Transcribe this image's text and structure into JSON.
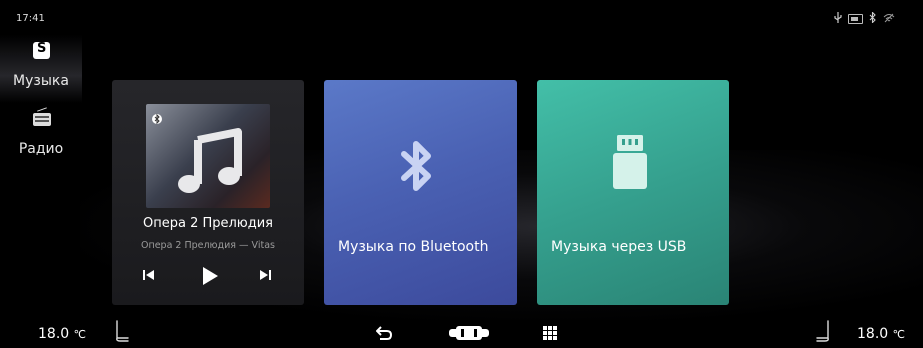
{
  "status_bar": {
    "time": "17:41",
    "icons": [
      "usb-icon",
      "battery-icon",
      "bluetooth-icon",
      "wifi-icon"
    ]
  },
  "sidebar": {
    "items": [
      {
        "label": "Музыка",
        "icon": "music-app-icon",
        "active": true
      },
      {
        "label": "Радио",
        "icon": "radio-icon",
        "active": false
      }
    ]
  },
  "player": {
    "title": "Опера 2 Прелюдия",
    "subtitle": "Опера 2 Прелюдия — Vitas",
    "controls": [
      "previous-icon",
      "play-icon",
      "next-icon"
    ]
  },
  "sources": [
    {
      "label": "Музыка по Bluetooth",
      "icon": "bluetooth-icon",
      "color": "#4a61b3"
    },
    {
      "label": "Музыка через USB",
      "icon": "usb-drive-icon",
      "color": "#35a08e"
    }
  ],
  "bottom_bar": {
    "temp_left": "18.0",
    "temp_right": "18.0",
    "unit": "℃",
    "icons": [
      "seat-left-icon",
      "back-icon",
      "car-icon",
      "apps-grid-icon",
      "seat-right-icon"
    ]
  }
}
